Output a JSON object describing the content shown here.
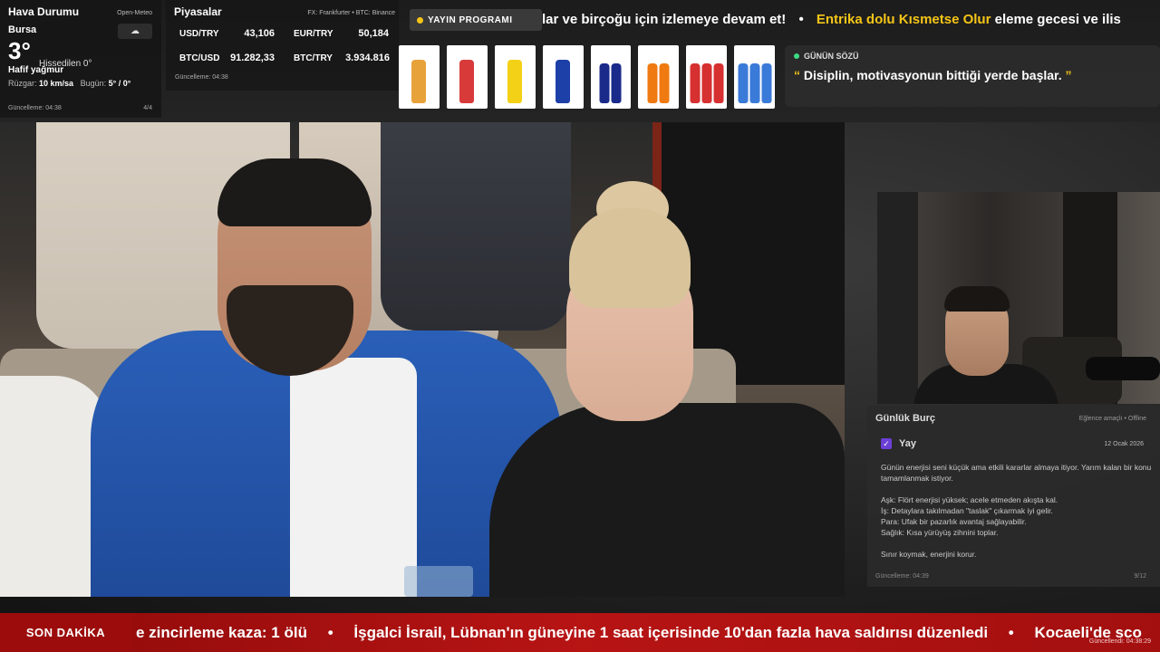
{
  "weather": {
    "title": "Hava Durumu",
    "source": "Open-Meteo",
    "city": "Bursa",
    "temp": "3°",
    "feels": "Hissedilen 0°",
    "condition": "Hafif yağmur",
    "wind_label": "Rüzgar:",
    "wind_value": "10 km/sa",
    "today_label": "Bugün:",
    "today_value": "5° / 0°",
    "updated": "Güncelleme: 04:38",
    "page": "4/4",
    "icon": "cloud-rain-icon"
  },
  "markets": {
    "title": "Piyasalar",
    "source": "FX: Frankfurter • BTC: Binance",
    "rows": [
      {
        "pair": "USD/TRY",
        "value": "43,106"
      },
      {
        "pair": "EUR/TRY",
        "value": "50,184"
      },
      {
        "pair": "BTC/USD",
        "value": "91.282,33"
      },
      {
        "pair": "BTC/TRY",
        "value": "3.934.816"
      }
    ],
    "updated": "Güncelleme: 04:38"
  },
  "schedule": {
    "label": "YAYIN PROGRAMI"
  },
  "top_ticker": {
    "part1": "lar ve birçoğu için izlemeye devam et!",
    "sep": "•",
    "highlight": "Entrika dolu Kısmetse Olur",
    "part2": "eleme gecesi ve ilis"
  },
  "products": [
    {
      "name": "lemon-soda-bottle",
      "color": "#e8a23a"
    },
    {
      "name": "water-bottle-red-label",
      "color": "#d83a3a"
    },
    {
      "name": "yellow-juice-bottle",
      "color": "#f3d116"
    },
    {
      "name": "blue-can",
      "color": "#1d3fa8"
    },
    {
      "name": "dark-blue-bottles",
      "color": "#1a2a8a"
    },
    {
      "name": "orange-drink-bottles",
      "color": "#f07a12"
    },
    {
      "name": "assorted-drinks",
      "color": "#d63030"
    },
    {
      "name": "water-bottles-blue",
      "color": "#3a7ad8"
    }
  ],
  "quote": {
    "title": "GÜNÜN SÖZÜ",
    "open": "“",
    "text": "Disiplin, motivasyonun bittiği yerde başlar.",
    "close": "”"
  },
  "horoscope": {
    "title": "Günlük Burç",
    "meta": "Eğlence amaçlı • Offline",
    "sign": "Yay",
    "date": "12 Ocak 2026",
    "intro": "Günün enerjisi seni küçük ama etkili kararlar almaya itiyor. Yarım kalan bir konu tamamlanmak istiyor.",
    "love_label": "Aşk:",
    "love": "Flört enerjisi yüksek; acele etmeden akışta kal.",
    "work_label": "İş:",
    "work": "Detaylara takılmadan \"taslak\" çıkarmak iyi gelir.",
    "money_label": "Para:",
    "money": "Ufak bir pazarlık avantaj sağlayabilir.",
    "health_label": "Sağlık:",
    "health": "Kısa yürüyüş zihnini toplar.",
    "closing": "Sınır koymak, enerjini korur.",
    "updated": "Güncelleme: 04:39",
    "page": "9/12"
  },
  "bottom_ticker": {
    "label": "SON DAKİKA",
    "items": [
      "e zincirleme kaza: 1 ölü",
      "İşgalci İsrail, Lübnan'ın güneyine 1 saat içerisinde 10'dan fazla hava saldırısı düzenledi",
      "Kocaeli'de sco"
    ],
    "sep": "•",
    "updated": "Güncellendi: 04:38:29"
  },
  "colors": {
    "accent": "#f5c518",
    "breaking": "#b71414",
    "quote_dot": "#3ddc84",
    "horo_check": "#6b3fd6"
  }
}
